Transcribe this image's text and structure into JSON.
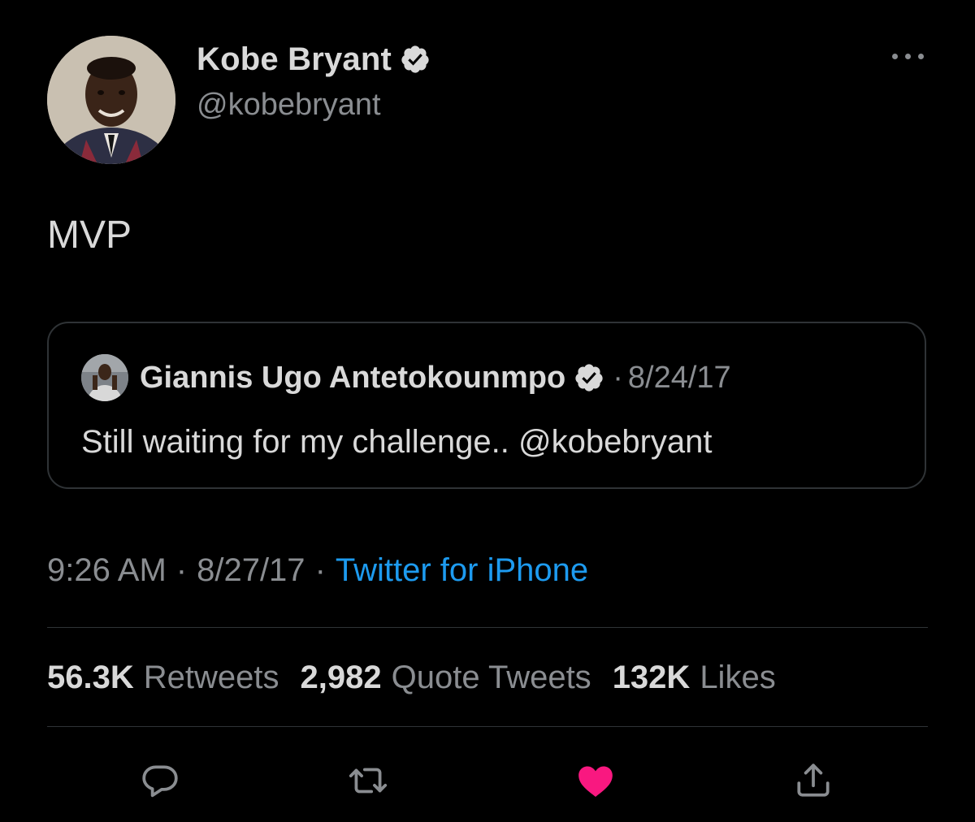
{
  "author": {
    "display_name": "Kobe Bryant",
    "handle": "@kobebryant",
    "verified": true
  },
  "tweet": {
    "text": "MVP",
    "time": "9:26 AM",
    "date": "8/27/17",
    "source": "Twitter for iPhone",
    "separator": "·"
  },
  "quoted_tweet": {
    "display_name": "Giannis Ugo Antetokounmpo",
    "verified": true,
    "separator": "·",
    "date": "8/24/17",
    "text": "Still waiting for my challenge.. @kobebryant"
  },
  "stats": [
    {
      "value": "56.3K",
      "label": "Retweets"
    },
    {
      "value": "2,982",
      "label": "Quote Tweets"
    },
    {
      "value": "132K",
      "label": "Likes"
    }
  ],
  "actions": [
    {
      "icon": "reply-icon"
    },
    {
      "icon": "retweet-icon"
    },
    {
      "icon": "heart-icon",
      "active": true
    },
    {
      "icon": "share-icon"
    }
  ],
  "colors": {
    "background": "#000000",
    "text": "#d9d9d9",
    "secondary": "#8a8d91",
    "link": "#1d9bf0",
    "like": "#f91880",
    "border": "#2f3336"
  }
}
